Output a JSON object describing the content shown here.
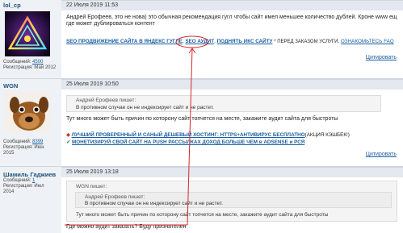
{
  "posts": [
    {
      "username": "lol_cp",
      "date": "22 Июля 2019 11:53",
      "messages_label": "Сообщений:",
      "messages_count": "4500",
      "reg_label": "Регистрация:",
      "reg_date": "Май 2012",
      "text_line1": "Андрей Ерофеев, это не нова) это обычная рекомендация гугл чтобы сайт имел меньшее количество дублей. Кроне ",
      "text_line1_tail": "www ещ",
      "text_line2": "где может дублироваться контент",
      "sig_link1": "SEO ПРОДВИЖЕНИЕ САЙТА В ЯНДЕКС ГУГЛЕ",
      "sig_sep1": ",",
      "sig_link2": "SEO АУДИТ",
      "sig_sep2": ",",
      "sig_link3": "ПОДНЯТЬ ИКС САЙТУ",
      "sig_text": "* ПЕРЕД ЗАКАЗОМ УСЛУГИ,",
      "sig_link4": "ОЗНАКОМЬТЕСЬ FAQ",
      "cite": "Цитировать"
    },
    {
      "username": "WGN",
      "date": "25 Июля 2019 10:50",
      "messages_label": "Сообщений:",
      "messages_count": "8399",
      "reg_label": "Регистрация:",
      "reg_date": "Июн",
      "reg_year": "2015",
      "quote_author": "Андрей Ерофеев пишет:",
      "quote_text": "В противном случае он не индексирует сайт и не растет.",
      "text": "Тут много может быть причин по которону сайт топчется на месте, закажите аудит сайта для быстроты",
      "sig_link1": "ЛУЧШИЙ ПРОВЕРЕННЫЙ И САНЫЙ ДЕШЕВЫЙ ХОСТИНГ: HTTPS+АНТИВИРУС БЕСПЛАТНО",
      "sig_text1": "(АКЦИЯ КЭШБЕК!)",
      "sig_link2": "МОНЕТИЗИРУЙ СВОЙ САЙТ НА PUSH РАССЫЛКАХ ДОХОД БОЛЬШЕ ЧЕМ в ADSENSE и РСЯ",
      "cite": "Цитировать"
    },
    {
      "username": "Шамиль Гаджиев",
      "date": "25 Июля 2019 13:18",
      "messages_label": "Сообщений:",
      "messages_count": "1",
      "reg_label": "Регистрация:",
      "reg_date": "Июл",
      "reg_year": "2014",
      "outer_quote_author": "WGN пишет:",
      "inner_quote_author": "Андрей Ерофеев пишет:",
      "inner_quote_text": "В противном случае он не индексирует сайт и не растет.",
      "outer_quote_text": "Тут много может быть причин по которону сайт топчется на месте, закажите аудит сайта для быстроты",
      "text": "Где можно аудит заказать? Буду признателен"
    }
  ],
  "colors": {
    "header_bg": "#e3e8ee",
    "side_bg": "#eef1f5",
    "link": "#1a5ea0",
    "highlight": "#d6252b"
  }
}
